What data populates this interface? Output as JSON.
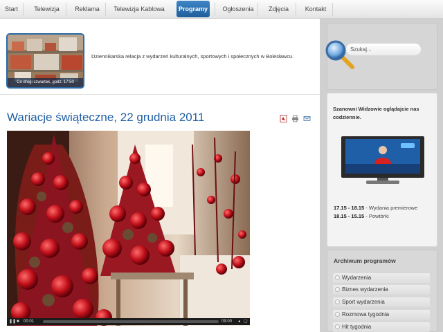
{
  "nav": {
    "items": [
      {
        "label": "Start",
        "active": false
      },
      {
        "label": "Telewizja",
        "active": false
      },
      {
        "label": "Reklama",
        "active": false
      },
      {
        "label": "Telewizja Kablowa",
        "active": false
      },
      {
        "label": "Programy",
        "active": true
      },
      {
        "label": "Ogłoszenia",
        "active": false
      },
      {
        "label": "Zdjęcia",
        "active": false
      },
      {
        "label": "Kontakt",
        "active": false
      }
    ]
  },
  "intro": {
    "thumbnail_caption": "Co drugi czwartek, godz. 17:50",
    "description": "Dziennikarska relacja z wydarzeń kulturalnych, sportowych i społecznych w Bolesławcu."
  },
  "article": {
    "title": "Wariacje świąteczne, 22 grudnia 2011",
    "tools": [
      "pdf-icon",
      "print-icon",
      "email-icon"
    ]
  },
  "video": {
    "time_elapsed": "00:01",
    "time_total": "09:00",
    "progress": 0.0
  },
  "sidebar": {
    "search_placeholder": "Szukaj...",
    "greeting": "Szanowni Widzowie oglądajcie nas codziennie.",
    "schedule": [
      {
        "time": "17.15 - 18.15",
        "desc": " - Wydania premierowe"
      },
      {
        "time": "18.15 - 15.15",
        "desc": " - Powtórki"
      }
    ],
    "archive_title": "Archiwum programów",
    "archive_items": [
      "Wydarzenia",
      "Biznes wydarzenia",
      "Sport wydarzenia",
      "Rozmowa tygodnia",
      "Hit tygodnia"
    ]
  },
  "colors": {
    "accent": "#2160a3",
    "nav_active": "#2a6fb0"
  }
}
